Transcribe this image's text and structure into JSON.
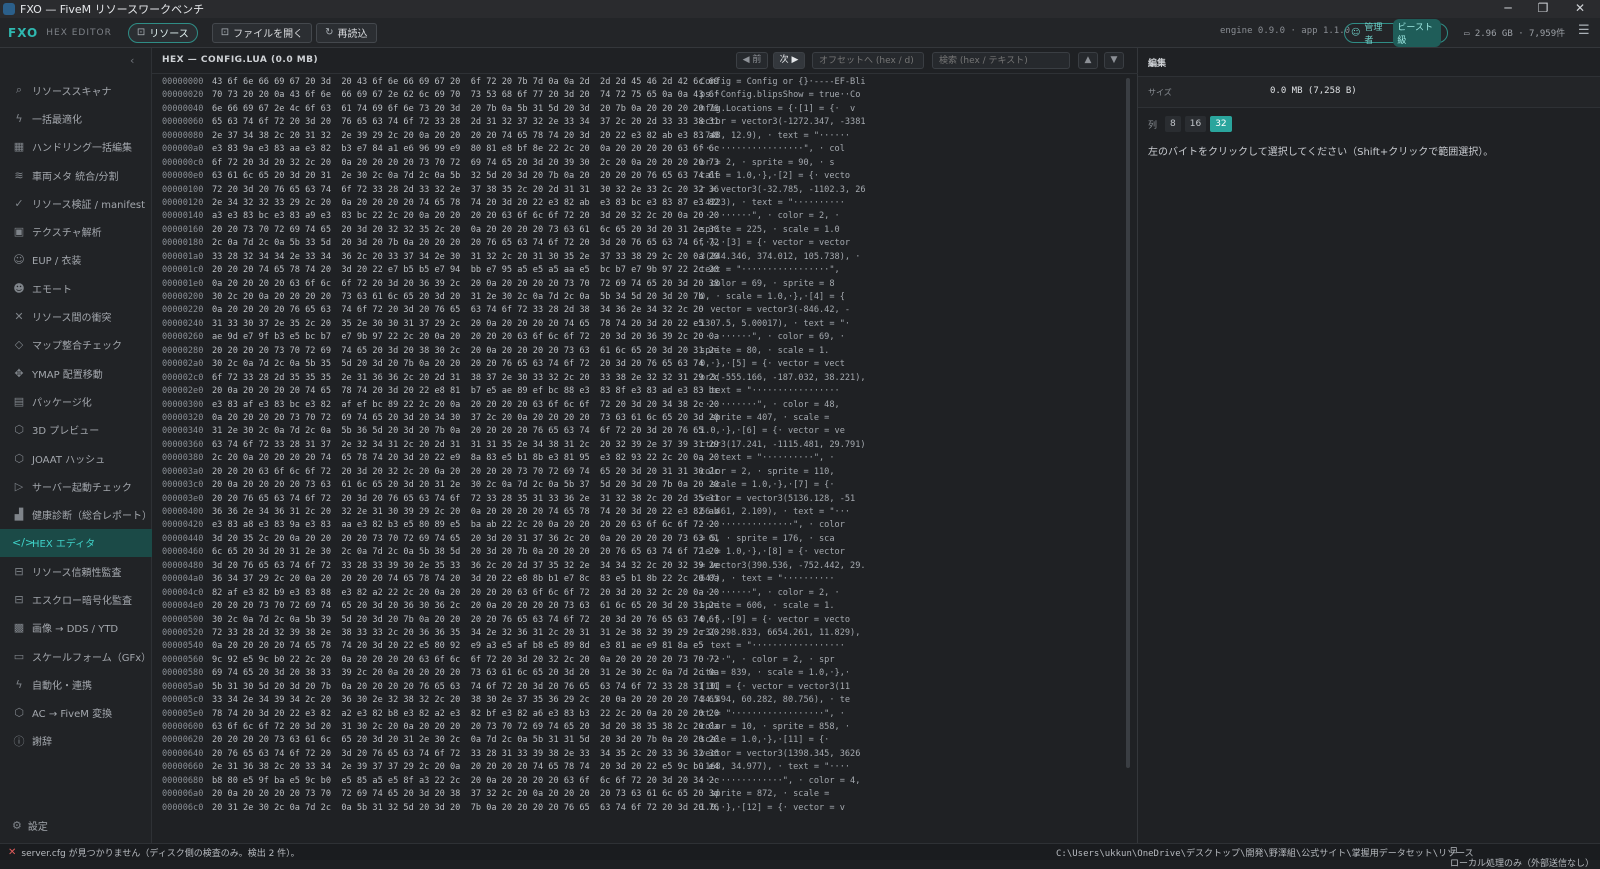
{
  "window": {
    "title": "FXO — FiveM リソースワークベンチ",
    "controls": [
      "─",
      "❐",
      "✕"
    ]
  },
  "toolbar": {
    "logo": "FXO",
    "logo_sub": "HEX EDITOR",
    "resource_label": "リソース",
    "open_label": "ファイルを開く",
    "reload_label": "再読込",
    "version": "engine 0.9.0 · app 1.1.0",
    "user_role": "管理者",
    "user_plan": "ビースト級",
    "memory": "2.96 GB · 7,959件"
  },
  "sidebar": {
    "items": [
      {
        "label": "リソーススキャナ",
        "icon": "search-icon",
        "glyph": "⌕"
      },
      {
        "label": "一括最適化",
        "icon": "bolt-icon",
        "glyph": "ϟ"
      },
      {
        "label": "ハンドリング一括編集",
        "icon": "grid-icon",
        "glyph": "▦"
      },
      {
        "label": "車両メタ 統合/分割",
        "icon": "layers-icon",
        "glyph": "≋"
      },
      {
        "label": "リソース検証 / manifest",
        "icon": "check-circle-icon",
        "glyph": "✓"
      },
      {
        "label": "テクスチャ解析",
        "icon": "image-icon",
        "glyph": "▣"
      },
      {
        "label": "EUP / 衣装",
        "icon": "user-icon",
        "glyph": "☺"
      },
      {
        "label": "エモート",
        "icon": "emote-icon",
        "glyph": "☻"
      },
      {
        "label": "リソース間の衝突",
        "icon": "close-icon",
        "glyph": "✕"
      },
      {
        "label": "マップ整合チェック",
        "icon": "diamond-icon",
        "glyph": "◇"
      },
      {
        "label": "YMAP 配置移動",
        "icon": "move-icon",
        "glyph": "✥"
      },
      {
        "label": "パッケージ化",
        "icon": "package-icon",
        "glyph": "▤"
      },
      {
        "label": "3D プレビュー",
        "icon": "cube-icon",
        "glyph": "⬡"
      },
      {
        "label": "JOAAT ハッシュ",
        "icon": "hash-icon",
        "glyph": "⬡"
      },
      {
        "label": "サーバー起動チェック",
        "icon": "play-icon",
        "glyph": "▷"
      },
      {
        "label": "健康診断（総合レポート）",
        "icon": "bar-chart-icon",
        "glyph": "▟"
      },
      {
        "label": "HEX エディタ",
        "icon": "code-icon",
        "glyph": "</>",
        "active": true
      },
      {
        "label": "リソース信頼性監査",
        "icon": "lock-icon",
        "glyph": "⊟"
      },
      {
        "label": "エスクロー暗号化監査",
        "icon": "lock-alt-icon",
        "glyph": "⊟"
      },
      {
        "label": "画像 → DDS / YTD",
        "icon": "checker-icon",
        "glyph": "▩"
      },
      {
        "label": "スケールフォーム（GFx）",
        "icon": "monitor-icon",
        "glyph": "▭"
      },
      {
        "label": "自動化・連携",
        "icon": "lightning-icon",
        "glyph": "ϟ"
      },
      {
        "label": "AC → FiveM 変換",
        "icon": "convert-icon",
        "glyph": "⬡"
      },
      {
        "label": "謝辞",
        "icon": "info-icon",
        "glyph": "ⓘ"
      }
    ],
    "settings_label": "設定"
  },
  "hex": {
    "file_label": "HEX — CONFIG.LUA  (0.0 MB)",
    "prev_label": "◀ 前",
    "next_label": "次 ▶",
    "offset_placeholder": "オフセットへ (hex / d)",
    "search_placeholder": "検索 (hex / テキスト)",
    "up": "▲",
    "down": "▼",
    "rows": [
      {
        "o": "00000000",
        "b": "43 6f 6e 66 69 67 20 3d  20 43 6f 6e 66 69 67 20  6f 72 20 7b 7d 0a 0a 2d  2d 2d 45 46 2d 42 6c 69",
        "a": "Config = Config or {}·----EF-Bli"
      },
      {
        "o": "00000020",
        "b": "70 73 20 20 0a 43 6f 6e  66 69 67 2e 62 6c 69 70  73 53 68 6f 77 20 3d 20  74 72 75 65 0a 0a 43 6f",
        "a": "ps ·Config.blipsShow = true··Co"
      },
      {
        "o": "00000040",
        "b": "6e 66 69 67 2e 4c 6f 63  61 74 69 6f 6e 73 20 3d  20 7b 0a 5b 31 5d 20 3d  20 7b 0a 20 20 20 20 76",
        "a": "nfig.Locations = {·[1] = {·  v"
      },
      {
        "o": "00000060",
        "b": "65 63 74 6f 72 20 3d 20  76 65 63 74 6f 72 33 28  2d 31 32 37 32 2e 33 34  37 2c 20 2d 33 33 38 31",
        "a": "ector = vector3(-1272.347, -3381"
      },
      {
        "o": "00000080",
        "b": "2e 37 34 38 2c 20 31 32  2e 39 29 2c 20 0a 20 20  20 20 74 65 78 74 20 3d  20 22 e3 82 ab e3 83 a8",
        "a": ".748, 12.9), · text = \"······"
      },
      {
        "o": "000000a0",
        "b": "e3 83 9a e3 83 aa e3 82  b3 e7 84 a1 e6 96 99 e9  80 81 e8 bf 8e 22 2c 20  0a 20 20 20 20 63 6f 6c",
        "a": "····················\", · col"
      },
      {
        "o": "000000c0",
        "b": "6f 72 20 3d 20 32 2c 20  0a 20 20 20 20 73 70 72  69 74 65 20 3d 20 39 30  2c 20 0a 20 20 20 20 73",
        "a": "or = 2, · sprite = 90, · s"
      },
      {
        "o": "000000e0",
        "b": "63 61 6c 65 20 3d 20 31  2e 30 2c 0a 7d 2c 0a 5b  32 5d 20 3d 20 7b 0a 20  20 20 20 76 65 63 74 6f",
        "a": "cale = 1.0,·},·[2] = {· vecto"
      },
      {
        "o": "00000100",
        "b": "72 20 3d 20 76 65 63 74  6f 72 33 28 2d 33 32 2e  37 38 35 2c 20 2d 31 31  30 32 2e 33 2c 20 32 36",
        "a": "r = vector3(-32.785, -1102.3, 26"
      },
      {
        "o": "00000120",
        "b": "2e 34 32 32 33 29 2c 20  0a 20 20 20 20 74 65 78  74 20 3d 20 22 e3 82 ab  e3 83 bc e3 83 87 e3 82",
        "a": ".4223), · text = \"··········"
      },
      {
        "o": "00000140",
        "b": "a3 e3 83 bc e3 83 a9 e3  83 bc 22 2c 20 0a 20 20  20 20 63 6f 6c 6f 72 20  3d 20 32 2c 20 0a 20 20",
        "a": "··········\", · color = 2, ·"
      },
      {
        "o": "00000160",
        "b": "20 20 73 70 72 69 74 65  20 3d 20 32 32 35 2c 20  0a 20 20 20 20 73 63 61  6c 65 20 3d 20 31 2e 30",
        "a": "sprite = 225, · scale = 1.0"
      },
      {
        "o": "00000180",
        "b": "2c 0a 7d 2c 0a 5b 33 5d  20 3d 20 7b 0a 20 20 20  20 76 65 63 74 6f 72 20  3d 20 76 65 63 74 6f 72",
        "a": ",·},·[3] = {· vector = vector"
      },
      {
        "o": "000001a0",
        "b": "33 28 32 34 34 2e 33 34  36 2c 20 33 37 34 2e 30  31 32 2c 20 31 30 35 2e  37 33 38 29 2c 20 0a 20",
        "a": "3(244.346, 374.012, 105.738), ·"
      },
      {
        "o": "000001c0",
        "b": "20 20 20 74 65 78 74 20  3d 20 22 e7 b5 b5 e7 94  bb e7 95 a5 e5 a5 aa e5  bc b7 e7 9b 97 22 2c 20",
        "a": "text = \"·················\","
      },
      {
        "o": "000001e0",
        "b": "0a 20 20 20 20 63 6f 6c  6f 72 20 3d 20 36 39 2c  20 0a 20 20 20 20 73 70  72 69 74 65 20 3d 20 38",
        "a": "· color = 69, · sprite = 8"
      },
      {
        "o": "00000200",
        "b": "30 2c 20 0a 20 20 20 20  73 63 61 6c 65 20 3d 20  31 2e 30 2c 0a 7d 2c 0a  5b 34 5d 20 3d 20 7b",
        "a": "0, · scale = 1.0,·},·[4] = {"
      },
      {
        "o": "00000220",
        "b": "0a 20 20 20 20 76 65 63  74 6f 72 20 3d 20 76 65  63 74 6f 72 33 28 2d 38  34 36 2e 34 32 2c 20",
        "a": "· vector = vector3(-846.42, -"
      },
      {
        "o": "00000240",
        "b": "31 33 30 37 2e 35 2c 20  35 2e 30 30 31 37 29 2c  20 0a 20 20 20 20 74 65  78 74 20 3d 20 22 e5",
        "a": "1307.5, 5.00017), · text = \"·"
      },
      {
        "o": "00000260",
        "b": "ae 9d e7 9f b3 e5 bc b7  e7 9b 97 22 2c 20 0a 20  20 20 20 63 6f 6c 6f 72  20 3d 20 36 39 2c 20 0a",
        "a": "··········\", · color = 69, ·"
      },
      {
        "o": "00000280",
        "b": "20 20 20 20 73 70 72 69  74 65 20 3d 20 38 30 2c  20 0a 20 20 20 20 73 63  61 6c 65 20 3d 20 31 2e",
        "a": "sprite = 80, · scale = 1."
      },
      {
        "o": "000002a0",
        "b": "30 2c 0a 7d 2c 0a 5b 35  5d 20 3d 20 7b 0a 20 20  20 20 76 65 63 74 6f 72  20 3d 20 76 65 63 74",
        "a": "0,·},·[5] = {· vector = vect"
      },
      {
        "o": "000002c0",
        "b": "6f 72 33 28 2d 35 35 35  2e 31 36 36 2c 20 2d 31  38 37 2e 30 33 32 2c 20  33 38 2e 32 32 31 29 2c",
        "a": "or3(-555.166, -187.032, 38.221),"
      },
      {
        "o": "000002e0",
        "b": "20 0a 20 20 20 20 74 65  78 74 20 3d 20 22 e8 81  b7 e5 ae 89 ef bc 88 e3  83 8f e3 83 ad e3 83 bc",
        "a": "· text = \"·················"
      },
      {
        "o": "00000300",
        "b": "e3 83 af e3 83 bc e3 82  af ef bc 89 22 2c 20 0a  20 20 20 20 63 6f 6c 6f  72 20 3d 20 34 38 2c 20",
        "a": "···········\", · color = 48,"
      },
      {
        "o": "00000320",
        "b": "0a 20 20 20 20 73 70 72  69 74 65 20 3d 20 34 30  37 2c 20 0a 20 20 20 20  73 63 61 6c 65 20 3d 20",
        "a": "· sprite = 407, · scale ="
      },
      {
        "o": "00000340",
        "b": "31 2e 30 2c 0a 7d 2c 0a  5b 36 5d 20 3d 20 7b 0a  20 20 20 20 76 65 63 74  6f 72 20 3d 20 76 65",
        "a": "1.0,·},·[6] = {· vector = ve"
      },
      {
        "o": "00000360",
        "b": "63 74 6f 72 33 28 31 37  2e 32 34 31 2c 20 2d 31  31 31 35 2e 34 38 31 2c  20 32 39 2e 37 39 31 29",
        "a": "ctor3(17.241, -1115.481, 29.791)"
      },
      {
        "o": "00000380",
        "b": "2c 20 0a 20 20 20 20 74  65 78 74 20 3d 20 22 e9  8a 83 e5 b1 8b e3 81 95  e3 82 93 22 2c 20 0a 20",
        "a": ", · text = \"··········\", ·"
      },
      {
        "o": "000003a0",
        "b": "20 20 20 63 6f 6c 6f 72  20 3d 20 32 2c 20 0a 20  20 20 20 73 70 72 69 74  65 20 3d 20 31 31 30 2c",
        "a": "color = 2, · sprite = 110,"
      },
      {
        "o": "000003c0",
        "b": "20 0a 20 20 20 20 73 63  61 6c 65 20 3d 20 31 2e  30 2c 0a 7d 2c 0a 5b 37  5d 20 3d 20 7b 0a 20 20",
        "a": "· scale = 1.0,·},·[7] = {·"
      },
      {
        "o": "000003e0",
        "b": "20 20 76 65 63 74 6f 72  20 3d 20 76 65 63 74 6f  72 33 28 35 31 33 36 2e  31 32 38 2c 20 2d 35 31",
        "a": "vector = vector3(5136.128, -51"
      },
      {
        "o": "00000400",
        "b": "36 36 2e 34 36 31 2c 20  32 2e 31 30 39 29 2c 20  0a 20 20 20 20 74 65 78  74 20 3d 20 22 e3 82 ab",
        "a": "66.461, 2.109), · text = \"···"
      },
      {
        "o": "00000420",
        "b": "e3 83 a8 e3 83 9a e3 83  aa e3 82 b3 e5 80 89 e5  ba ab 22 2c 20 0a 20 20  20 20 63 6f 6c 6f 72 20",
        "a": "··················\", · color"
      },
      {
        "o": "00000440",
        "b": "3d 20 35 2c 20 0a 20 20  20 20 73 70 72 69 74 65  20 3d 20 31 37 36 2c 20  0a 20 20 20 20 73 63 61",
        "a": "= 5, · sprite = 176, · sca"
      },
      {
        "o": "00000460",
        "b": "6c 65 20 3d 20 31 2e 30  2c 0a 7d 2c 0a 5b 38 5d  20 3d 20 7b 0a 20 20 20  20 76 65 63 74 6f 72 20",
        "a": "le = 1.0,·},·[8] = {· vector"
      },
      {
        "o": "00000480",
        "b": "3d 20 76 65 63 74 6f 72  33 28 33 39 30 2e 35 33  36 2c 20 2d 37 35 32 2e  34 34 32 2c 20 32 39 2e",
        "a": "= vector3(390.536, -752.442, 29."
      },
      {
        "o": "000004a0",
        "b": "36 34 37 29 2c 20 0a 20  20 20 20 74 65 78 74 20  3d 20 22 e8 8b b1 e7 8c  83 e5 b1 8b 22 2c 20 0a",
        "a": "647), · text = \"··········"
      },
      {
        "o": "000004c0",
        "b": "82 af e3 82 b9 e3 83 88  e3 82 a2 22 2c 20 0a 20  20 20 20 63 6f 6c 6f 72  20 3d 20 32 2c 20 0a 20",
        "a": "··········\", · color = 2, ·"
      },
      {
        "o": "000004e0",
        "b": "20 20 20 73 70 72 69 74  65 20 3d 20 36 30 36 2c  20 0a 20 20 20 20 73 63  61 6c 65 20 3d 20 31 2e",
        "a": "sprite = 606, · scale = 1."
      },
      {
        "o": "00000500",
        "b": "30 2c 0a 7d 2c 0a 5b 39  5d 20 3d 20 7b 0a 20 20  20 20 76 65 63 74 6f 72  20 3d 20 76 65 63 74 6f",
        "a": "0,·},·[9] = {· vector = vecto"
      },
      {
        "o": "00000520",
        "b": "72 33 28 2d 32 39 38 2e  38 33 33 2c 20 36 36 35  34 2e 32 36 31 2c 20 31  31 2e 38 32 39 29 2c 20",
        "a": "r3(-298.833, 6654.261, 11.829),"
      },
      {
        "o": "00000540",
        "b": "0a 20 20 20 20 74 65 78  74 20 3d 20 22 e5 80 92  e9 a3 e5 af b8 e5 89 8d  e3 81 ae e9 81 8a e5",
        "a": "· text = \"··················"
      },
      {
        "o": "00000560",
        "b": "9c 92 e5 9c b0 22 2c 20  0a 20 20 20 20 63 6f 6c  6f 72 20 3d 20 32 2c 20  0a 20 20 20 20 73 70 72",
        "a": "·····\", · color = 2, · spr"
      },
      {
        "o": "00000580",
        "b": "69 74 65 20 3d 20 38 33  39 2c 20 0a 20 20 20 20  73 63 61 6c 65 20 3d 20  31 2e 30 2c 0a 7d 2c 0a",
        "a": "ite = 839, · scale = 1.0,·},·"
      },
      {
        "o": "000005a0",
        "b": "5b 31 30 5d 20 3d 20 7b  0a 20 20 20 20 76 65 63  74 6f 72 20 3d 20 76 65  63 74 6f 72 33 28 31 31",
        "a": "[10] = {· vector = vector3(11"
      },
      {
        "o": "000005c0",
        "b": "33 34 2e 34 39 34 2c 20  36 30 2e 32 38 32 2c 20  38 30 2e 37 35 36 29 2c  20 0a 20 20 20 20 74 65",
        "a": "34.494, 60.282, 80.756), · te"
      },
      {
        "o": "000005e0",
        "b": "78 74 20 3d 20 22 e3 82  a2 e3 82 b8 e3 82 a2 e3  82 bf e3 82 a6 e3 83 b3  22 2c 20 0a 20 20 20 20",
        "a": "xt = \"··················\", ·"
      },
      {
        "o": "00000600",
        "b": "63 6f 6c 6f 72 20 3d 20  31 30 2c 20 0a 20 20 20  20 73 70 72 69 74 65 20  3d 20 38 35 38 2c 20 0a",
        "a": "color = 10, · sprite = 858, ·"
      },
      {
        "o": "00000620",
        "b": "20 20 20 20 73 63 61 6c  65 20 3d 20 31 2e 30 2c  0a 7d 2c 0a 5b 31 31 5d  20 3d 20 7b 0a 20 20 20",
        "a": "scale = 1.0,·},·[11] = {·"
      },
      {
        "o": "00000640",
        "b": "20 76 65 63 74 6f 72 20  3d 20 76 65 63 74 6f 72  33 28 31 33 39 38 2e 33  34 35 2c 20 33 36 32 36",
        "a": "vector = vector3(1398.345, 3626"
      },
      {
        "o": "00000660",
        "b": "2e 31 36 38 2c 20 33 34  2e 39 37 37 29 2c 20 0a  20 20 20 20 74 65 78 74  20 3d 20 22 e5 9c b0 e4",
        "a": ".168, 34.977), · text = \"····"
      },
      {
        "o": "00000680",
        "b": "b8 80 e5 9f ba e5 9c b0  e5 85 a5 e5 8f a3 22 2c  20 0a 20 20 20 20 63 6f  6c 6f 72 20 3d 20 34 2c",
        "a": "················\", · color = 4,"
      },
      {
        "o": "000006a0",
        "b": "20 0a 20 20 20 20 73 70  72 69 74 65 20 3d 20 38  37 32 2c 20 0a 20 20 20  20 73 63 61 6c 65 20 3d",
        "a": "· sprite = 872, · scale ="
      },
      {
        "o": "000006c0",
        "b": "20 31 2e 30 2c 0a 7d 2c  0a 5b 31 32 5d 20 3d 20  7b 0a 20 20 20 20 76 65  63 74 6f 72 20 3d 20 76",
        "a": "1.0,·},·[12] = {· vector = v"
      }
    ]
  },
  "edit": {
    "header": "編集",
    "size_label": "サイズ",
    "size_value": "0.0 MB (7,258 B)",
    "cols_label": "列",
    "col_options": [
      "8",
      "16",
      "32"
    ],
    "col_selected": "32",
    "hint": "左のバイトをクリックして選択してください（Shift+クリックで範囲選択）。"
  },
  "status": {
    "error_icon": "✕",
    "message": "server.cfg が見つかりません（ディスク側の検査のみ。検出 2 件）。",
    "path": "C:\\Users\\ukkun\\OneDrive\\デスクトップ\\開発\\野澤組\\公式サイト\\掌握用データセット\\リソース",
    "local": "ローカル処理のみ（外部送信なし）"
  },
  "colors": {
    "accent": "#2fb8b0",
    "active_bg": "#1b4a47",
    "error": "#e25c5c"
  }
}
